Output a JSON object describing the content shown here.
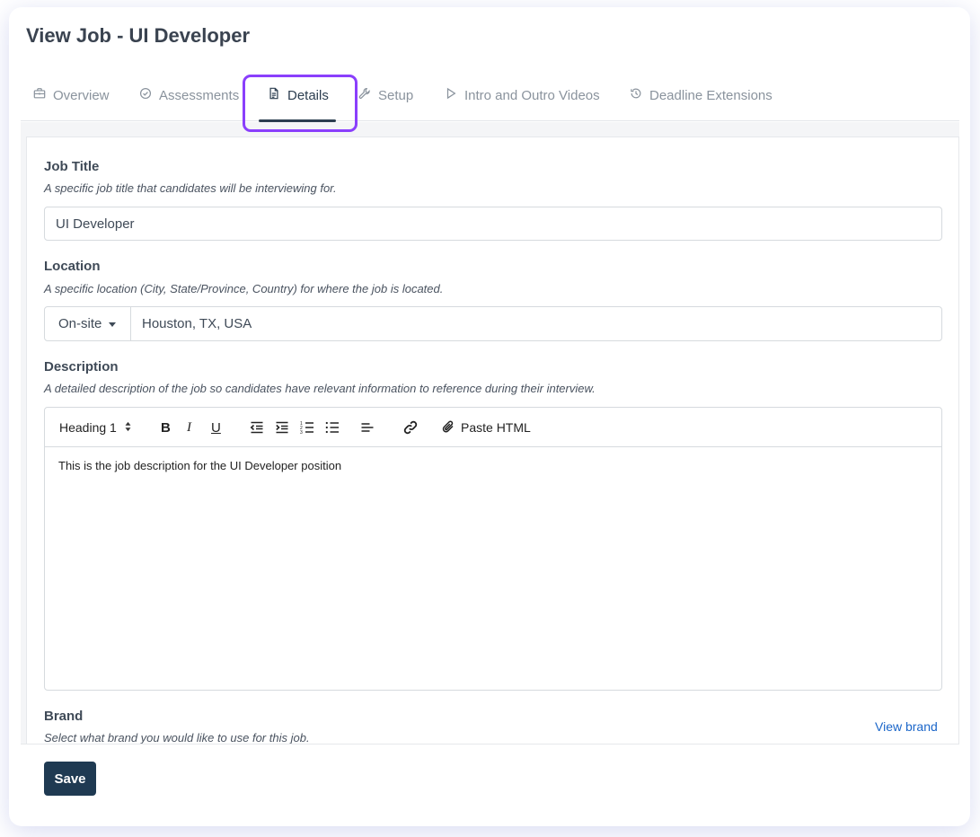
{
  "page": {
    "title": "View Job - UI Developer"
  },
  "tabs": [
    {
      "label": "Overview",
      "icon": "briefcase-icon"
    },
    {
      "label": "Assessments",
      "icon": "check-circle-icon"
    },
    {
      "label": "Details",
      "icon": "document-icon",
      "active": true
    },
    {
      "label": "Setup",
      "icon": "wrench-icon"
    },
    {
      "label": "Intro and Outro Videos",
      "icon": "play-icon"
    },
    {
      "label": "Deadline Extensions",
      "icon": "history-icon"
    }
  ],
  "form": {
    "job_title": {
      "label": "Job Title",
      "help": "A specific job title that candidates will be interviewing for.",
      "value": "UI Developer"
    },
    "location": {
      "label": "Location",
      "help": "A specific location (City, State/Province, Country) for where the job is located.",
      "type_value": "On-site",
      "value": "Houston, TX, USA"
    },
    "description": {
      "label": "Description",
      "help": "A detailed description of the job so candidates have relevant information to reference during their interview.",
      "toolbar": {
        "heading_select": "Heading 1",
        "paste_html": "Paste HTML"
      },
      "body": "This is the job description for the UI Developer position"
    },
    "brand": {
      "label": "Brand",
      "help": "Select what brand you would like to use for this job.",
      "view_link": "View brand"
    }
  },
  "footer": {
    "save_label": "Save"
  },
  "colors": {
    "accent": "#1f3a52",
    "highlight": "#8a3ffc",
    "link": "#1b66c9"
  }
}
